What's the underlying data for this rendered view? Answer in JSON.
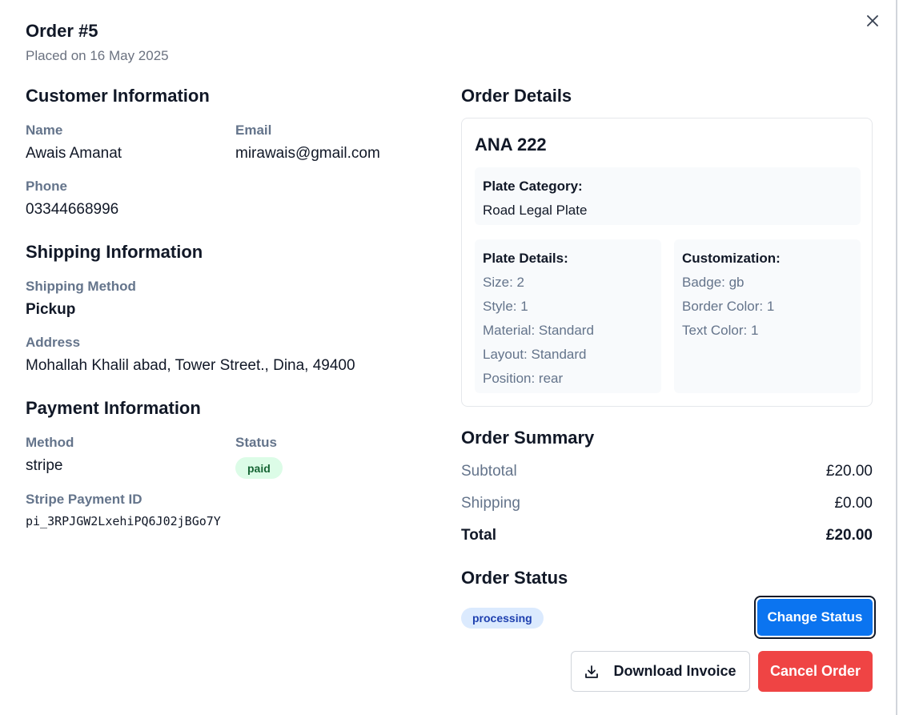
{
  "header": {
    "title": "Order #5",
    "placed_on": "Placed on 16 May 2025"
  },
  "customer": {
    "section_title": "Customer Information",
    "name_label": "Name",
    "name": "Awais Amanat",
    "email_label": "Email",
    "email": "mirawais@gmail.com",
    "phone_label": "Phone",
    "phone": "03344668996"
  },
  "shipping": {
    "section_title": "Shipping Information",
    "method_label": "Shipping Method",
    "method": "Pickup",
    "address_label": "Address",
    "address": "Mohallah Khalil abad, Tower Street., Dina, 49400"
  },
  "payment": {
    "section_title": "Payment Information",
    "method_label": "Method",
    "method": "stripe",
    "status_label": "Status",
    "status": "paid",
    "stripe_id_label": "Stripe Payment ID",
    "stripe_id": "pi_3RPJGW2LxehiPQ6J02jBGo7Y"
  },
  "order_details": {
    "section_title": "Order Details",
    "plate_text": "ANA 222",
    "category_label": "Plate Category:",
    "category": "Road Legal Plate",
    "plate_details_label": "Plate Details:",
    "plate_details": [
      "Size: 2",
      "Style: 1",
      "Material: Standard",
      "Layout: Standard",
      "Position: rear"
    ],
    "customization_label": "Customization:",
    "customization": [
      "Badge: gb",
      "Border Color: 1",
      "Text Color: 1"
    ]
  },
  "summary": {
    "section_title": "Order Summary",
    "subtotal_label": "Subtotal",
    "subtotal": "£20.00",
    "shipping_label": "Shipping",
    "shipping": "£0.00",
    "total_label": "Total",
    "total": "£20.00"
  },
  "status": {
    "section_title": "Order Status",
    "value": "processing",
    "change_button": "Change Status"
  },
  "actions": {
    "download_invoice": "Download Invoice",
    "cancel_order": "Cancel Order"
  },
  "icons": {
    "close": "close-icon",
    "download": "download-icon"
  },
  "colors": {
    "primary": "#0b74f0",
    "danger": "#ef4444",
    "paid_bg": "#dcfce7",
    "processing_bg": "#dbeafe"
  }
}
